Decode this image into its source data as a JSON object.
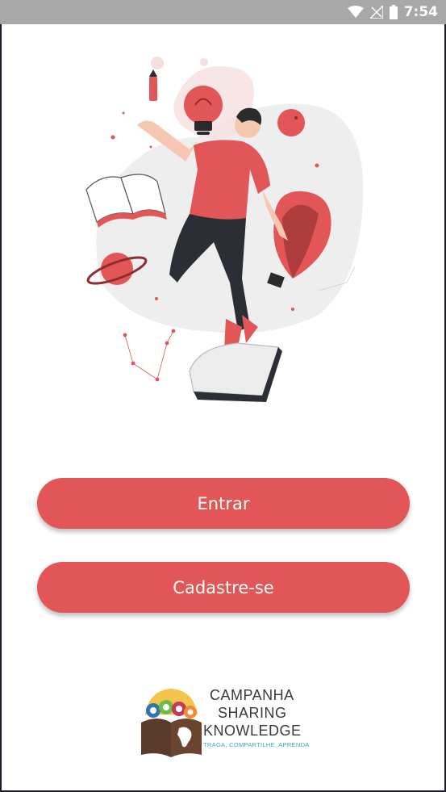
{
  "status_bar": {
    "time": "7:54",
    "icons": [
      "wifi-icon",
      "signal-icon",
      "battery-icon"
    ]
  },
  "illustration": {
    "name": "person-juggling-ideas"
  },
  "buttons": {
    "login_label": "Entrar",
    "signup_label": "Cadastre-se"
  },
  "logo": {
    "line1": "CAMPANHA",
    "line2": "SHARING",
    "line3": "KNOWLEDGE",
    "tagline": "TRAGA, COMPARTILHE, APRENDA"
  },
  "colors": {
    "accent": "#e35657",
    "status_bar": "#a8a8a8"
  }
}
